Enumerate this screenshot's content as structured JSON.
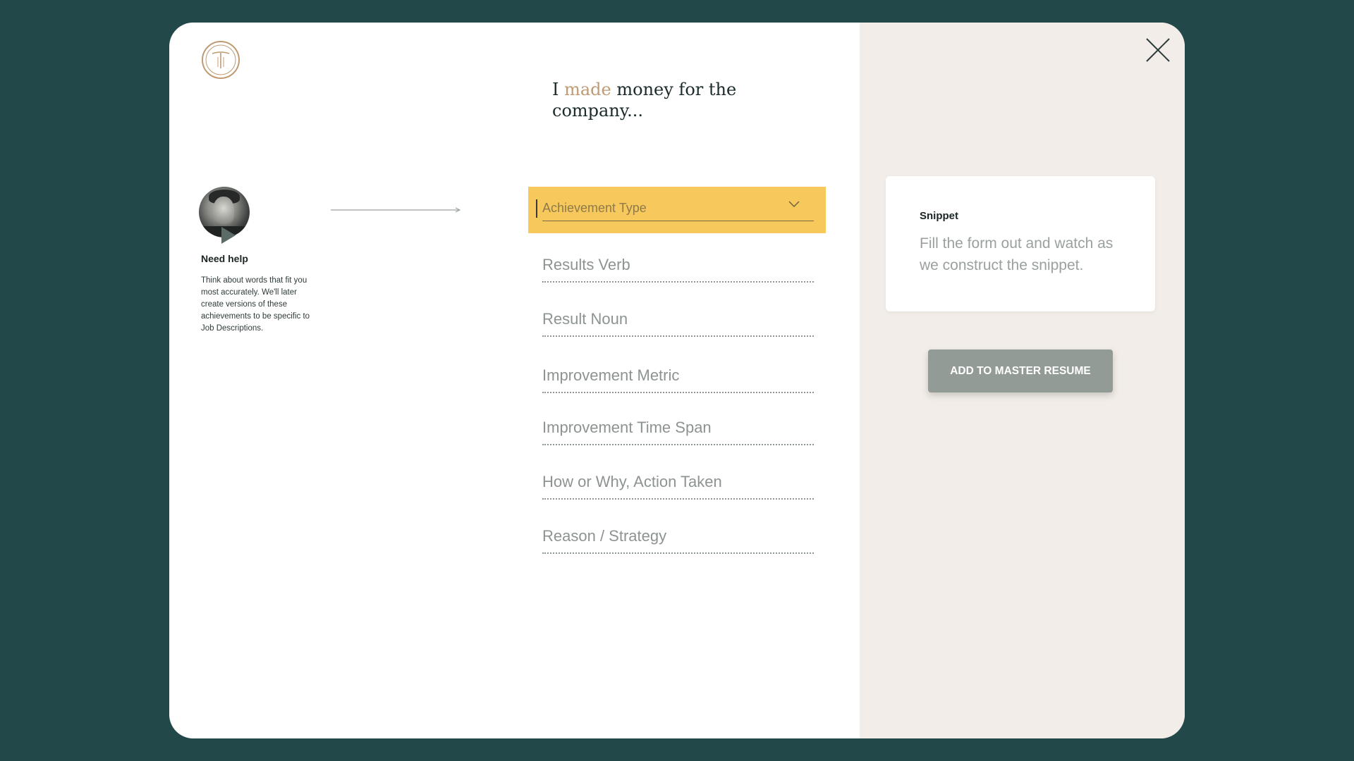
{
  "headline": {
    "prefix": "I ",
    "accent_word": "made",
    "suffix": " money for the company..."
  },
  "help": {
    "title": "Need help",
    "text": "Think about words that fit you most accurately. We'll later create versions of these achievements to be specific to Job Descriptions."
  },
  "form": {
    "dropdown_label": "Achievement Type",
    "fields": [
      "Results Verb",
      "Result Noun",
      "Improvement Metric",
      "Improvement Time Span",
      "How or Why, Action Taken",
      "Reason / Strategy"
    ]
  },
  "snippet": {
    "title": "Snippet",
    "body": "Fill the form out and watch as we construct the snippet."
  },
  "add_button_label": "ADD TO MASTER RESUME",
  "colors": {
    "background": "#23484a",
    "accent_gold": "#bf9a73",
    "dropdown_active": "#f7c95d",
    "side_panel": "#f2ede8",
    "button": "#939b96"
  },
  "icons": {
    "logo": "monogram-t-logo",
    "close": "close-icon",
    "play": "play-icon",
    "arrow": "arrow-right-icon",
    "chevron": "chevron-down-icon"
  }
}
